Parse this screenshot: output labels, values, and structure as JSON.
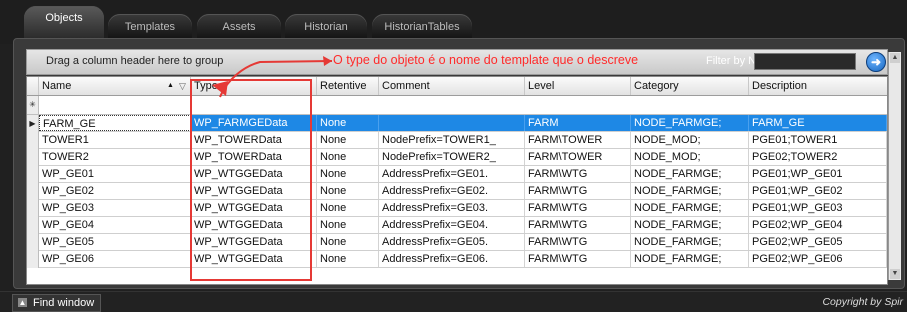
{
  "tabs": [
    {
      "label": "Objects",
      "active": true
    },
    {
      "label": "Templates",
      "active": false
    },
    {
      "label": "Assets",
      "active": false
    },
    {
      "label": "Historian",
      "active": false
    },
    {
      "label": "HistorianTables",
      "active": false
    }
  ],
  "toolbar": {
    "group_hint": "Drag a column header here to group",
    "filter_label": "Filter by Name:",
    "filter_value": "",
    "filter_button_icon": "go-arrow-icon"
  },
  "annotation": {
    "text": "O type do objeto é o nome do template que o descreve",
    "color": "#e53935"
  },
  "grid": {
    "columns": [
      "Name",
      "Type",
      "Retentive",
      "Comment",
      "Level",
      "Category",
      "Description"
    ],
    "sort_indicator": "▲",
    "selected_row_index": 0,
    "rows": [
      {
        "name": "FARM_GE",
        "type": "WP_FARMGEData",
        "retentive": "None",
        "comment": "",
        "level": "FARM",
        "category": "NODE_FARMGE;",
        "description": "FARM_GE"
      },
      {
        "name": "TOWER1",
        "type": "WP_TOWERData",
        "retentive": "None",
        "comment": "NodePrefix=TOWER1_",
        "level": "FARM\\TOWER",
        "category": "NODE_MOD;",
        "description": "PGE01;TOWER1"
      },
      {
        "name": "TOWER2",
        "type": "WP_TOWERData",
        "retentive": "None",
        "comment": "NodePrefix=TOWER2_",
        "level": "FARM\\TOWER",
        "category": "NODE_MOD;",
        "description": "PGE02;TOWER2"
      },
      {
        "name": "WP_GE01",
        "type": "WP_WTGGEData",
        "retentive": "None",
        "comment": "AddressPrefix=GE01.",
        "level": "FARM\\WTG",
        "category": "NODE_FARMGE;",
        "description": "PGE01;WP_GE01"
      },
      {
        "name": "WP_GE02",
        "type": "WP_WTGGEData",
        "retentive": "None",
        "comment": "AddressPrefix=GE02.",
        "level": "FARM\\WTG",
        "category": "NODE_FARMGE;",
        "description": "PGE01;WP_GE02"
      },
      {
        "name": "WP_GE03",
        "type": "WP_WTGGEData",
        "retentive": "None",
        "comment": "AddressPrefix=GE03.",
        "level": "FARM\\WTG",
        "category": "NODE_FARMGE;",
        "description": "PGE01;WP_GE03"
      },
      {
        "name": "WP_GE04",
        "type": "WP_WTGGEData",
        "retentive": "None",
        "comment": "AddressPrefix=GE04.",
        "level": "FARM\\WTG",
        "category": "NODE_FARMGE;",
        "description": "PGE02;WP_GE04"
      },
      {
        "name": "WP_GE05",
        "type": "WP_WTGGEData",
        "retentive": "None",
        "comment": "AddressPrefix=GE05.",
        "level": "FARM\\WTG",
        "category": "NODE_FARMGE;",
        "description": "PGE02;WP_GE05"
      },
      {
        "name": "WP_GE06",
        "type": "WP_WTGGEData",
        "retentive": "None",
        "comment": "AddressPrefix=GE06.",
        "level": "FARM\\WTG",
        "category": "NODE_FARMGE;",
        "description": "PGE02;WP_GE06"
      }
    ]
  },
  "bottom": {
    "find_label": "Find window",
    "copyright": "Copyright by Spir"
  },
  "colors": {
    "selection": "#1e88e5",
    "annotation": "#e53935"
  }
}
